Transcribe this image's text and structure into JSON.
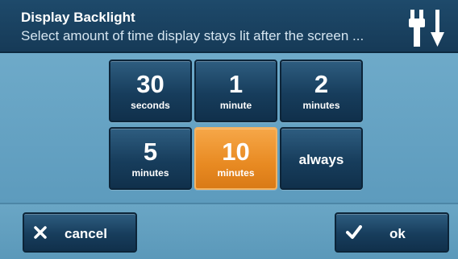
{
  "header": {
    "title": "Display Backlight",
    "subtitle": "Select amount of time display stays lit after the screen ...",
    "icon": "power-plug-icon"
  },
  "options": [
    {
      "value": "30",
      "unit": "seconds",
      "selected": false
    },
    {
      "value": "1",
      "unit": "minute",
      "selected": false
    },
    {
      "value": "2",
      "unit": "minutes",
      "selected": false
    },
    {
      "value": "5",
      "unit": "minutes",
      "selected": false
    },
    {
      "value": "10",
      "unit": "minutes",
      "selected": true
    },
    {
      "label": "always",
      "selected": false
    }
  ],
  "footer": {
    "cancel_label": "cancel",
    "cancel_icon": "close-icon",
    "ok_label": "ok",
    "ok_icon": "checkmark-icon"
  },
  "colors": {
    "tile": "#173d5c",
    "selected": "#e88a22",
    "background": "#6da8c6",
    "header": "#1e4a6b"
  }
}
